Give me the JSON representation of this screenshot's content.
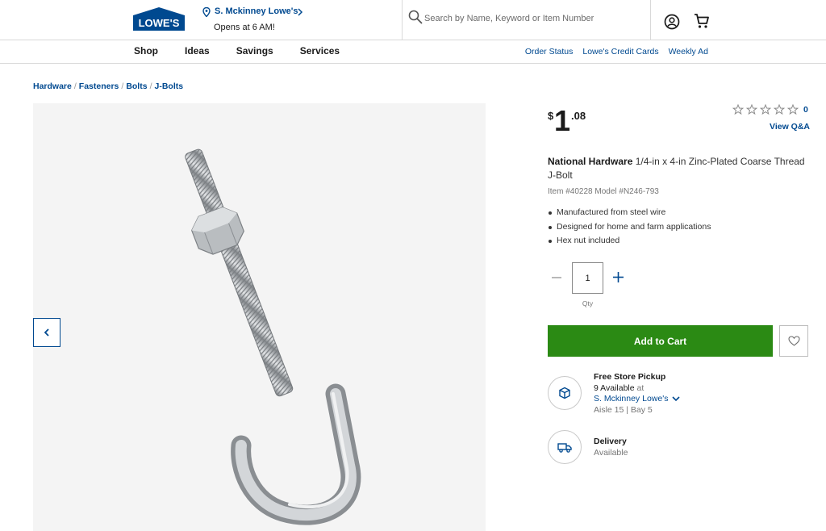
{
  "header": {
    "logo_text": "LOWE'S",
    "store_name": "S. Mckinney Lowe's",
    "store_hours": "Opens at 6 AM!",
    "search_placeholder": "Search by Name, Keyword or Item Number"
  },
  "nav": {
    "main": [
      "Shop",
      "Ideas",
      "Savings",
      "Services"
    ],
    "right": [
      "Order Status",
      "Lowe's Credit Cards",
      "Weekly Ad"
    ]
  },
  "breadcrumb": [
    "Hardware",
    "Fasteners",
    "Bolts",
    "J-Bolts"
  ],
  "product": {
    "price_symbol": "$",
    "price_whole": "1",
    "price_cents": ".08",
    "rating": 0,
    "review_count": "0",
    "view_qa": "View Q&A",
    "brand": "National Hardware",
    "name": "1/4-in x 4-in Zinc-Plated Coarse Thread J-Bolt",
    "item_model": "Item #40228  Model #N246-793",
    "bullets": [
      "Manufactured from steel wire",
      "Designed for home and farm applications",
      "Hex nut included"
    ]
  },
  "quantity": {
    "value": "1",
    "label": "Qty"
  },
  "add_to_cart_label": "Add to Cart",
  "fulfillment": {
    "pickup_title": "Free Store Pickup",
    "pickup_count": "9 Available",
    "pickup_at": "at",
    "pickup_store": "S. Mckinney Lowe's",
    "pickup_aisle": "Aisle 15 | Bay 5",
    "delivery_title": "Delivery",
    "delivery_status": "Available"
  },
  "colors": {
    "brand_blue": "#004990",
    "cart_green": "#2b8a14"
  }
}
